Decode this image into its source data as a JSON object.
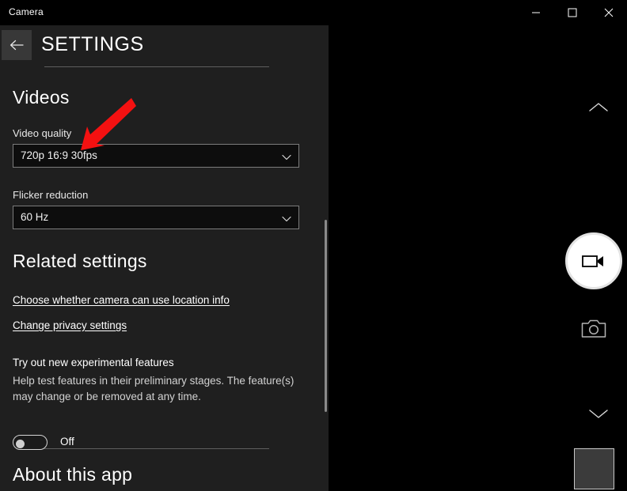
{
  "window": {
    "title": "Camera",
    "controls": {
      "minimize": "Minimize",
      "maximize": "Maximize",
      "close": "Close"
    }
  },
  "settings": {
    "back_label": "Back",
    "page_title": "SETTINGS",
    "sections": {
      "videos": {
        "heading": "Videos",
        "video_quality": {
          "label": "Video quality",
          "value": "720p 16:9 30fps"
        },
        "flicker_reduction": {
          "label": "Flicker reduction",
          "value": "60 Hz"
        }
      },
      "related": {
        "heading": "Related settings",
        "links": [
          "Choose whether camera can use location info",
          "Change privacy settings"
        ],
        "experimental": {
          "title": "Try out new experimental features",
          "description": "Help test features in their preliminary stages. The feature(s) may change or be removed at any time.",
          "toggle_state": "Off"
        }
      },
      "about": {
        "heading": "About this app"
      }
    }
  },
  "camera_controls": {
    "scroll_up_label": "More options",
    "record_video_label": "Take video",
    "take_photo_label": "Take photo",
    "scroll_down_label": "Fewer options",
    "gallery_thumbnail_label": "Recent capture",
    "gallery_thumbnail_caption": " "
  },
  "annotation": {
    "arrow_color": "#f41111",
    "points_at": "Video quality"
  },
  "colors": {
    "panel_background": "#1f1f1f",
    "app_background": "#000000",
    "combo_background": "#0d0d0d",
    "combo_border": "#7c7c7c",
    "text_primary": "#ffffff",
    "accent_arrow": "#f41111"
  }
}
